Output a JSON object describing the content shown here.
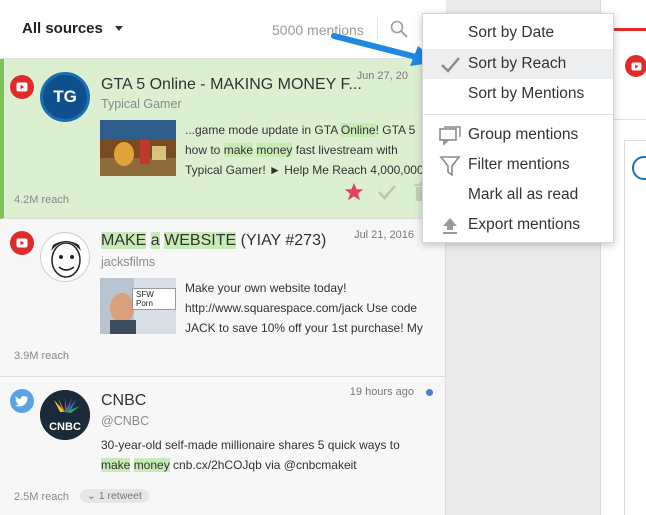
{
  "header": {
    "sources_label": "All sources",
    "mentions_count": "5000 mentions"
  },
  "mentions": [
    {
      "source": "youtube",
      "title": "GTA 5 Online - MAKING MONEY F...",
      "author": "Typical Gamer",
      "date": "Jun 27, 20",
      "snippet_parts": [
        {
          "t": "...game mode update in GTA "
        },
        {
          "t": "Online",
          "hl": true
        },
        {
          "t": "! GTA 5 how to "
        },
        {
          "t": "make",
          "hl": true
        },
        {
          "t": " "
        },
        {
          "t": "money",
          "hl": true
        },
        {
          "t": " fast livestream with Typical Gamer! ► Help Me Reach 4,000,000"
        }
      ],
      "reach": "4.2M reach",
      "active": true
    },
    {
      "source": "youtube",
      "title_parts": [
        {
          "t": "MAKE",
          "hl": true
        },
        {
          "t": " "
        },
        {
          "t": "a",
          "hl": true
        },
        {
          "t": " "
        },
        {
          "t": "WEBSITE",
          "hl": true
        },
        {
          "t": " (YIAY #273)"
        }
      ],
      "author": "jacksfilms",
      "date": "Jul 21, 2016",
      "thumb_label": "SFW Porn",
      "snippet": "Make your own website today! http://www.squarespace.com/jack Use code JACK to save 10% off your 1st purchase! My",
      "reach": "3.9M reach"
    },
    {
      "source": "twitter",
      "title": "CNBC",
      "author": "@CNBC",
      "date": "19 hours ago",
      "avatar_text": "CNBC",
      "snippet_parts": [
        {
          "t": "30-year-old self-made millionaire shares 5 quick ways to "
        },
        {
          "t": "make",
          "hl": true
        },
        {
          "t": " "
        },
        {
          "t": "money",
          "hl": true
        },
        {
          "t": " cnb.cx/2hCOJqb via @cnbcmakeit"
        }
      ],
      "reach": "2.5M reach",
      "retweets": "1 retweet"
    }
  ],
  "avatar_1_text": "TG",
  "menu": {
    "items": [
      {
        "label": "Sort by Date"
      },
      {
        "label": "Sort by Reach",
        "selected": true
      },
      {
        "label": "Sort by Mentions"
      },
      {
        "label": "Group mentions"
      },
      {
        "label": "Filter mentions"
      },
      {
        "label": "Mark all as read"
      },
      {
        "label": "Export mentions"
      }
    ]
  },
  "colors": {
    "active_highlight": "#dcf0d1",
    "active_border": "#7cc456",
    "keyword_highlight": "#c7ebb4",
    "youtube_red": "#e02b2b",
    "twitter_blue": "#5ba2e4",
    "star_pink": "#e0435a",
    "arrow_blue": "#1e88e5"
  },
  "icons": {
    "search": "search-icon",
    "check": "checkmark-icon",
    "group": "chat-bubble-icon",
    "filter": "funnel-icon",
    "export": "upload-icon",
    "star": "star-icon",
    "trash": "trash-icon"
  }
}
